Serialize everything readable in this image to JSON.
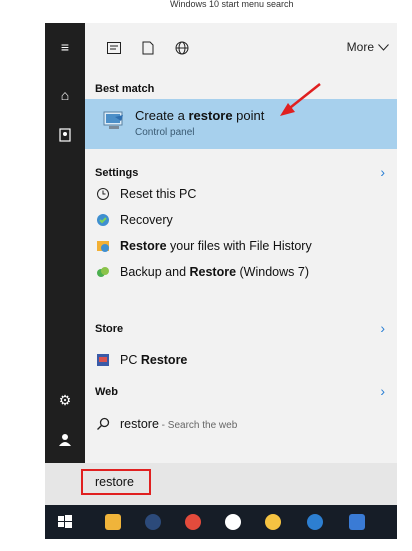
{
  "caption": "Windows 10 start menu search",
  "topbar": {
    "more_label": "More"
  },
  "sections": {
    "best_match": "Best match",
    "settings": "Settings",
    "store": "Store",
    "web": "Web"
  },
  "best_match_item": {
    "prefix": "Create a ",
    "bold": "restore",
    "suffix": " point",
    "subtitle": "Control panel"
  },
  "settings_items": [
    {
      "pre": "Reset this PC",
      "bold": "",
      "post": ""
    },
    {
      "pre": "Recovery",
      "bold": "",
      "post": ""
    },
    {
      "pre": "",
      "bold": "Restore",
      "post": " your files with File History"
    },
    {
      "pre": "Backup and ",
      "bold": "Restore",
      "post": " (Windows 7)"
    }
  ],
  "store_item": {
    "pre": "PC ",
    "bold": "Restore"
  },
  "web_item": {
    "bold": "restore",
    "hint": " - Search the web"
  },
  "search": {
    "query": "restore"
  },
  "colors": {
    "highlight": "#a7d0ed",
    "accent": "#2a7fd4",
    "sidebar": "#1f1f1f",
    "taskbar": "#161d27",
    "annotation": "#e02020"
  }
}
